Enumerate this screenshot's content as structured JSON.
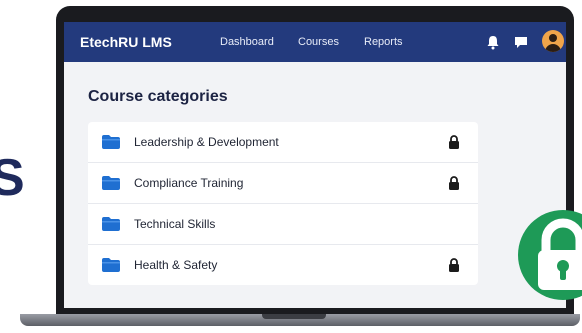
{
  "header": {
    "app_title": "EtechRU LMS",
    "nav": [
      "Dashboard",
      "Courses",
      "Reports"
    ]
  },
  "main": {
    "section_title": "Course categories",
    "categories": [
      {
        "label": "Leadership & Development",
        "locked": true
      },
      {
        "label": "Compliance Training",
        "locked": true
      },
      {
        "label": "Technical Skills",
        "locked": false
      },
      {
        "label": "Health & Safety",
        "locked": true
      }
    ]
  },
  "colors": {
    "topbar": "#233a7d",
    "folder": "#1f6fd1",
    "lock_badge": "#1e9a57"
  },
  "icons": [
    "bell-icon",
    "chat-icon",
    "avatar",
    "folder-icon",
    "lock-icon"
  ],
  "decor": {
    "side_glyph": "S"
  }
}
